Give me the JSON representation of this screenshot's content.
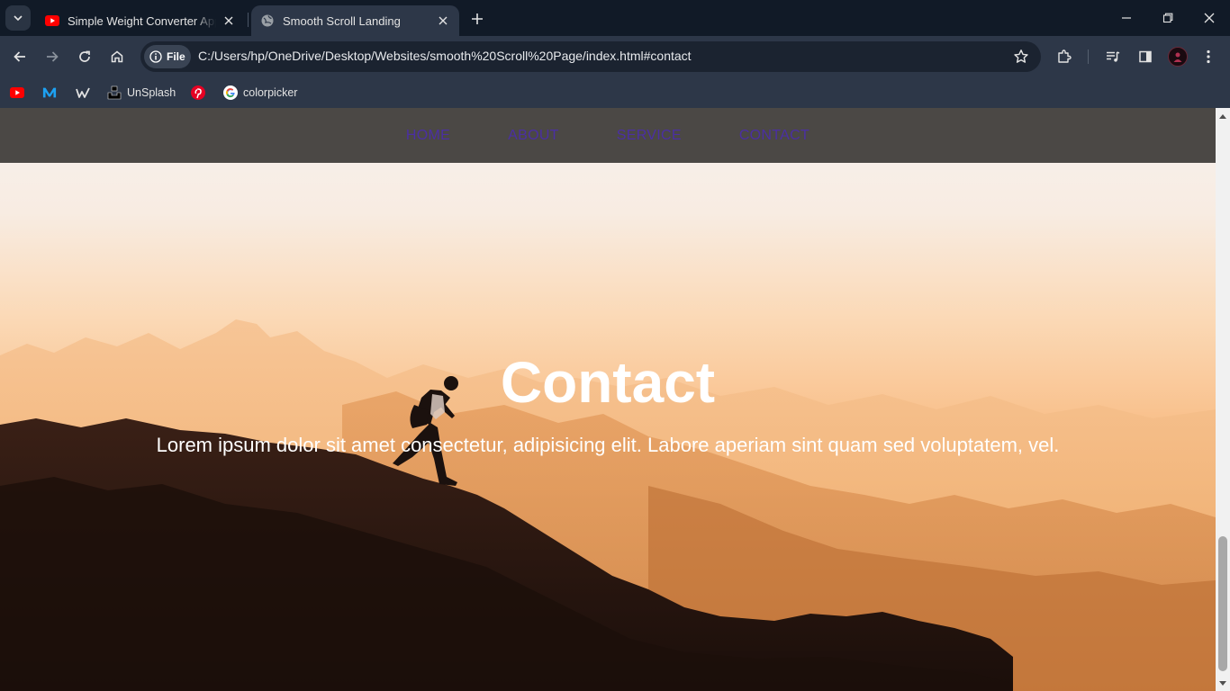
{
  "browser": {
    "tabs": [
      {
        "title": "Simple Weight Converter App W",
        "favicon": "youtube-icon",
        "active": false
      },
      {
        "title": "Smooth Scroll Landing",
        "favicon": "globe-icon",
        "active": true
      }
    ],
    "address_bar": {
      "chip_label": "File",
      "url": "C:/Users/hp/OneDrive/Desktop/Websites/smooth%20Scroll%20Page/index.html#contact"
    },
    "bookmarks": [
      {
        "label": "",
        "icon": "youtube-icon"
      },
      {
        "label": "",
        "icon": "medium-m-icon"
      },
      {
        "label": "",
        "icon": "webflow-icon"
      },
      {
        "label": "UnSplash",
        "icon": "unsplash-icon"
      },
      {
        "label": "",
        "icon": "pinterest-icon"
      },
      {
        "label": "colorpicker",
        "icon": "google-icon"
      }
    ]
  },
  "page": {
    "nav": [
      "HOME",
      "ABOUT",
      "SERVICE",
      "CONTACT"
    ],
    "section_title": "Contact",
    "section_text": "Lorem ipsum dolor sit amet consectetur, adipisicing elit. Labore aperiam sint quam sed voluptatem, vel.",
    "nav_link_color": "#4b2fa3",
    "navbar_color": "#3c3a36"
  }
}
